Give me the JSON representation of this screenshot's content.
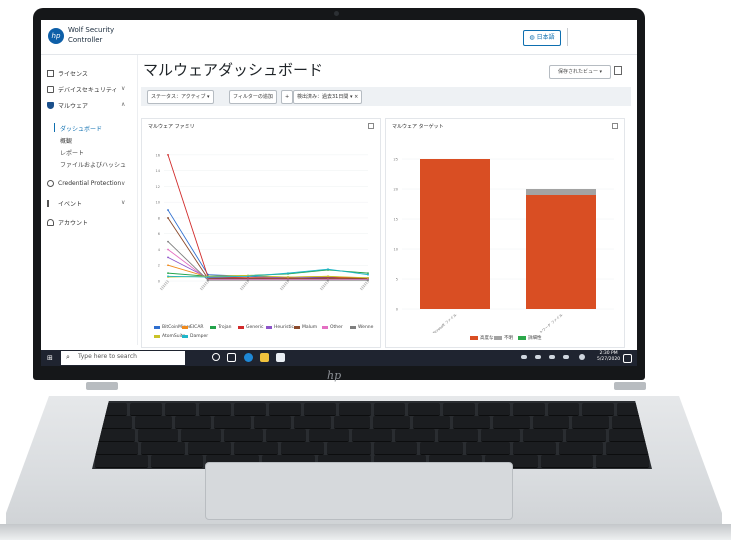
{
  "app": {
    "logo_text": "hp",
    "brand_line1": "Wolf Security",
    "brand_line2": "Controller",
    "language_button": "日本語"
  },
  "sidebar": {
    "items": [
      {
        "label": "ライセンス"
      },
      {
        "label": "デバイスセキュリティ"
      },
      {
        "label": "マルウェア"
      },
      {
        "label": "Credential Protection"
      },
      {
        "label": "イベント"
      },
      {
        "label": "アカウント"
      }
    ],
    "malware_sub": [
      {
        "label": "ダッシュボード"
      },
      {
        "label": "概観"
      },
      {
        "label": "レポート"
      },
      {
        "label": "ファイルおよびハッシュ"
      }
    ]
  },
  "main": {
    "title": "マルウェアダッシュボード",
    "saved_view": "保存されたビュー",
    "filters": [
      {
        "label": "ステータス：アクティブ"
      },
      {
        "label": "フィルターの追加"
      },
      {
        "label": "検出済み：過去31日間"
      }
    ]
  },
  "cards": {
    "family_title": "マルウェア ファミリ",
    "target_title": "マルウェア ターゲット"
  },
  "chart_data": [
    {
      "type": "line",
      "title": "マルウェア ファミリ",
      "series": [
        {
          "name": "BitCoinMiner",
          "color": "#2f6fcf",
          "values": [
            9,
            0.8,
            0.6,
            0.4,
            0.5,
            0.3
          ]
        },
        {
          "name": "EICAR",
          "color": "#f08a1c",
          "values": [
            2,
            0.5,
            0.4,
            0.5,
            0.6,
            0.3
          ]
        },
        {
          "name": "Trojan",
          "color": "#23a34a",
          "values": [
            1,
            0.6,
            0.7,
            0.9,
            1.4,
            1.0
          ]
        },
        {
          "name": "Generic",
          "color": "#d12b2b",
          "values": [
            16,
            0.5,
            0.4,
            0.4,
            0.4,
            0.4
          ]
        },
        {
          "name": "Heuristic",
          "color": "#8d54c9",
          "values": [
            3,
            0.4,
            0.3,
            0.5,
            0.3,
            0.2
          ]
        },
        {
          "name": "Malum",
          "color": "#8b4a2c",
          "values": [
            8,
            0.3,
            0.3,
            0.3,
            0.3,
            0.3
          ]
        },
        {
          "name": "Other",
          "color": "#e46fc2",
          "values": [
            4,
            0.2,
            0.2,
            0.2,
            0.2,
            0.2
          ]
        },
        {
          "name": "Wenne",
          "color": "#7f7f7f",
          "values": [
            5,
            0.1,
            0.1,
            0.1,
            0.1,
            0.1
          ]
        },
        {
          "name": "AtomSuite",
          "color": "#c9c228",
          "values": [
            0.5,
            0.6,
            0.7,
            0.5,
            0.6,
            0.4
          ]
        },
        {
          "name": "Damper",
          "color": "#1fb6c9",
          "values": [
            0.6,
            0.5,
            0.6,
            1.0,
            1.5,
            0.8
          ]
        }
      ],
      "ylim": [
        0,
        17
      ],
      "yticks": [
        "16",
        "14",
        "12",
        "10",
        "8",
        "6",
        "4",
        "2",
        "0"
      ]
    },
    {
      "type": "bar",
      "title": "マルウェア ターゲット",
      "categories": [
        "Microsoft ファイル",
        "ネットワーク ファイル"
      ],
      "series": [
        {
          "name": "高度な",
          "color": "#d94e23",
          "values": [
            25,
            19
          ]
        },
        {
          "name": "不明",
          "color": "#a3a3a3",
          "values": [
            0,
            1
          ]
        },
        {
          "name": "詳細性",
          "color": "#2ca84a",
          "values": [
            0,
            0
          ]
        }
      ],
      "ylim": [
        0,
        27
      ],
      "yticks": [
        "25",
        "20",
        "15",
        "10",
        "5",
        "0"
      ]
    }
  ],
  "taskbar": {
    "search_placeholder": "Type here to search",
    "time": "2:30 PM",
    "date": "5/27/2020"
  },
  "hardware": {
    "bezel_logo": "hp"
  }
}
